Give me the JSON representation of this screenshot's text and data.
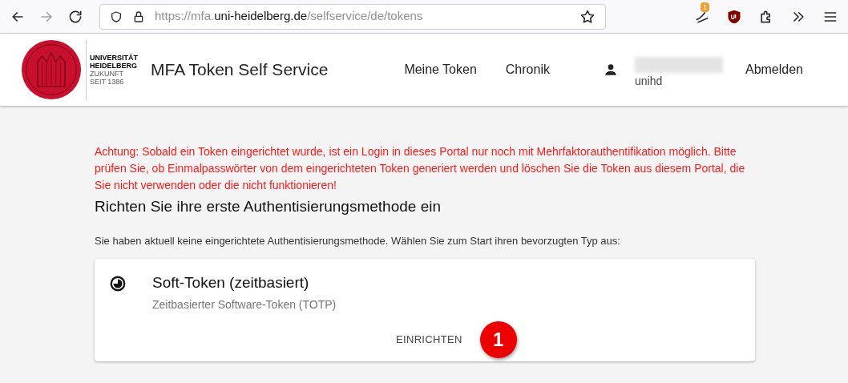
{
  "browser": {
    "url_parts": [
      {
        "text": "https://mfa.",
        "emphasis": false
      },
      {
        "text": "uni-heidelberg.de",
        "emphasis": true
      },
      {
        "text": "/selfservice/de/tokens",
        "emphasis": false
      }
    ],
    "extension_badge": "1"
  },
  "header": {
    "logo": {
      "line_1": "UNIVERSITÄT",
      "line_2": "HEIDELBERG",
      "line_3": "ZUKUNFT",
      "line_4": "SEIT 1386"
    },
    "title": "MFA Token Self Service",
    "nav": [
      "Meine Token",
      "Chronik"
    ],
    "user": {
      "name_redacted": true,
      "realm": "unihd"
    },
    "logout": "Abmelden"
  },
  "warning": "Achtung: Sobald ein Token eingerichtet wurde, ist ein Login in dieses Portal nur noch mit Mehrfaktorauthentifikation möglich. Bitte prüfen Sie, ob Einmalpasswörter von dem eingerichteten Token generiert werden und löschen Sie die Token aus diesem Portal, die Sie nicht verwenden oder die nicht funktionieren!",
  "heading": "Richten Sie ihre erste Authentisierungsmethode ein",
  "intro": "Sie haben aktuell keine eingerichtete Authentisierungsmethode. Wählen Sie zum Start ihren bevorzugten Typ aus:",
  "token_card": {
    "title": "Soft-Token (zeitbasiert)",
    "subtitle": "Zeitbasierter Software-Token (TOTP)",
    "action": "EINRICHTEN",
    "step_marker": "1"
  }
}
